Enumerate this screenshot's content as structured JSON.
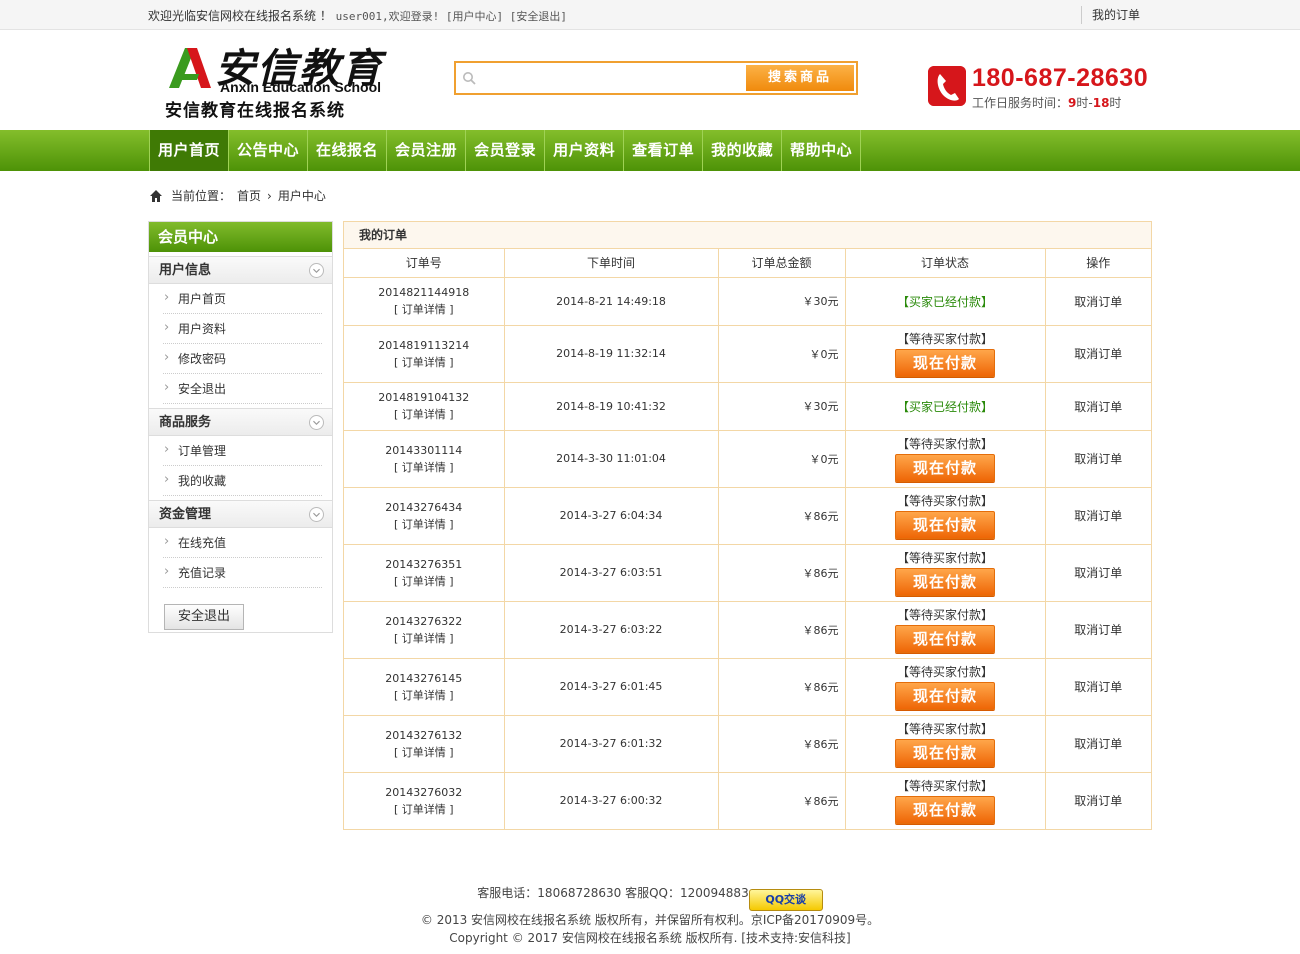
{
  "topbar": {
    "welcome": "欢迎光临安信网校在线报名系统 ！",
    "links": "user001,欢迎登录! [用户中心] [安全退出]",
    "my_orders": "我的订单"
  },
  "logo": {
    "cn_big": "安信教育",
    "en": "Anxin Education School",
    "cn_sub": "安信教育在线报名系统"
  },
  "search": {
    "placeholder": "",
    "button": "搜索商品"
  },
  "contact": {
    "phone": "180-687-28630",
    "hours_prefix": "工作日服务时间：",
    "hours_start": "9",
    "hours_mid": "时-",
    "hours_end": "18",
    "hours_suffix": "时"
  },
  "nav": [
    "用户首页",
    "公告中心",
    "在线报名",
    "会员注册",
    "会员登录",
    "用户资料",
    "查看订单",
    "我的收藏",
    "帮助中心"
  ],
  "breadcrumb": {
    "label": "当前位置：",
    "home": "首页",
    "sep": "›",
    "current": "用户中心"
  },
  "sidebar": {
    "title": "会员中心",
    "groups": [
      {
        "title": "用户信息",
        "items": [
          "用户首页",
          "用户资料",
          "修改密码",
          "安全退出"
        ]
      },
      {
        "title": "商品服务",
        "items": [
          "订单管理",
          "我的收藏"
        ]
      },
      {
        "title": "资金管理",
        "items": [
          "在线充值",
          "充值记录"
        ]
      }
    ],
    "logout": "安全退出"
  },
  "orders": {
    "title": "我的订单",
    "columns": [
      "订单号",
      "下单时间",
      "订单总金额",
      "订单状态",
      "操作"
    ],
    "detail_label": "[ 订单详情 ]",
    "pay_label": "现在付款",
    "cancel_label": "取消订单",
    "rows": [
      {
        "id": "2014821144918",
        "time": "2014-8-21 14:49:18",
        "amount": "￥30元",
        "status": "【买家已经付款】",
        "paid": true
      },
      {
        "id": "2014819113214",
        "time": "2014-8-19 11:32:14",
        "amount": "￥0元",
        "status": "【等待买家付款】",
        "paid": false
      },
      {
        "id": "2014819104132",
        "time": "2014-8-19 10:41:32",
        "amount": "￥30元",
        "status": "【买家已经付款】",
        "paid": true
      },
      {
        "id": "20143301114",
        "time": "2014-3-30 11:01:04",
        "amount": "￥0元",
        "status": "【等待买家付款】",
        "paid": false
      },
      {
        "id": "20143276434",
        "time": "2014-3-27 6:04:34",
        "amount": "￥86元",
        "status": "【等待买家付款】",
        "paid": false
      },
      {
        "id": "20143276351",
        "time": "2014-3-27 6:03:51",
        "amount": "￥86元",
        "status": "【等待买家付款】",
        "paid": false
      },
      {
        "id": "20143276322",
        "time": "2014-3-27 6:03:22",
        "amount": "￥86元",
        "status": "【等待买家付款】",
        "paid": false
      },
      {
        "id": "20143276145",
        "time": "2014-3-27 6:01:45",
        "amount": "￥86元",
        "status": "【等待买家付款】",
        "paid": false
      },
      {
        "id": "20143276132",
        "time": "2014-3-27 6:01:32",
        "amount": "￥86元",
        "status": "【等待买家付款】",
        "paid": false
      },
      {
        "id": "20143276032",
        "time": "2014-3-27 6:00:32",
        "amount": "￥86元",
        "status": "【等待买家付款】",
        "paid": false
      }
    ]
  },
  "footer": {
    "line1": "客服电话：18068728630 客服QQ：120094883",
    "qq_button": "QQ交谈",
    "line2": "© 2013 安信网校在线报名系统 版权所有，并保留所有权利。京ICP备20170909号。",
    "line3": "Copyright © 2017 安信网校在线报名系统 版权所有. [技术支持:安信科技]"
  },
  "colors": {
    "nav_green": "#5a9f0f",
    "accent_orange": "#f08a0c",
    "phone_red": "#d6161b",
    "paid_green": "#2a8a0a"
  }
}
